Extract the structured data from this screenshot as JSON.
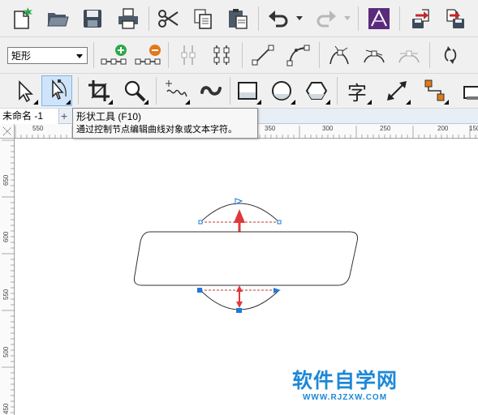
{
  "toolbar_standard": {
    "new_icon": "new-document-icon",
    "open_icon": "open-folder-icon",
    "save_icon": "save-icon",
    "print_icon": "print-icon",
    "cut_icon": "scissors-icon",
    "copy_icon": "copy-icon",
    "paste_icon": "paste-icon",
    "undo_icon": "undo-icon",
    "redo_icon": "redo-icon",
    "app_launcher_icon": "app-launcher-icon",
    "import_icon": "import-icon",
    "export_icon": "export-icon"
  },
  "property_bar": {
    "object_type": "矩形",
    "add_node_icon": "add-node-icon",
    "delete_node_icon": "delete-node-icon"
  },
  "toolbox": {
    "pick_tool_icon": "pick-tool-icon",
    "shape_tool_icon": "shape-tool-icon",
    "crop_tool_icon": "crop-tool-icon",
    "zoom_tool_icon": "zoom-tool-icon",
    "freehand_tool_icon": "freehand-tool-icon",
    "artistic_media_icon": "artistic-media-icon",
    "rectangle_tool_icon": "rectangle-tool-icon",
    "ellipse_tool_icon": "ellipse-tool-icon",
    "polygon_tool_icon": "polygon-tool-icon",
    "text_tool_label": "字",
    "dimension_tool_icon": "dimension-tool-icon",
    "connector_tool_icon": "connector-tool-icon",
    "shadow_tool_icon": "drop-shadow-tool-icon"
  },
  "document": {
    "tab_label": "未命名 -1",
    "add_tab": "+"
  },
  "tooltip": {
    "title": "形状工具 (F10)",
    "description": "通过控制节点编辑曲线对象或文本字符。"
  },
  "ruler": {
    "h_labels": [
      "550",
      "350",
      "300",
      "250",
      "200",
      "150"
    ],
    "v_labels": [
      "650",
      "600",
      "550",
      "500",
      "450"
    ]
  },
  "watermark": {
    "main": "软件自学网",
    "url": "WWW.RJZXW.COM"
  },
  "colors": {
    "accent": "#1e88d8",
    "node_blue": "#1e7ad8",
    "arrow_red": "#e0383a",
    "dashed_red": "#c0392b"
  }
}
